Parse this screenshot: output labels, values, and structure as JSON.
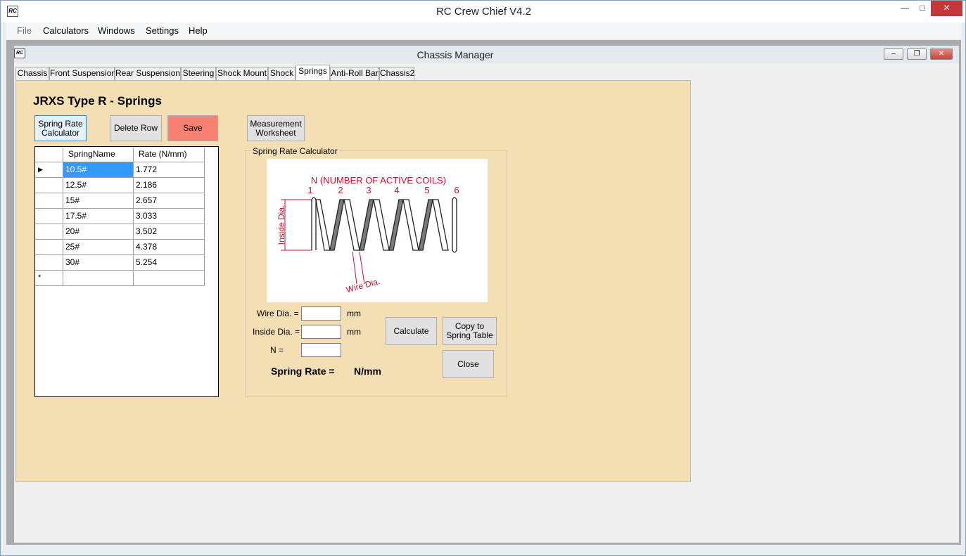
{
  "app": {
    "title": "RC Crew Chief V4.2",
    "icon_text": "RC",
    "minimize_glyph": "—",
    "maximize_glyph": "□",
    "close_glyph": "✕"
  },
  "menu": [
    "File",
    "Calculators",
    "Windows",
    "Settings",
    "Help"
  ],
  "child_window": {
    "title": "Chassis Manager",
    "icon_text": "RC",
    "min_glyph": "–",
    "restore_glyph": "❐",
    "close_glyph": "✕"
  },
  "tabs": [
    "Chassis",
    "Front Suspension",
    "Rear Suspension",
    "Steering",
    "Shock Mount",
    "Shock",
    "Springs",
    "Anti-Roll Bar",
    "Chassis2"
  ],
  "active_tab": "Springs",
  "page": {
    "heading": "JRXS Type R - Springs",
    "buttons": {
      "spring_rate_calc": "Spring Rate Calculator",
      "delete_row": "Delete Row",
      "save": "Save",
      "measurement": "Measurement Worksheet"
    },
    "save_color": "#fa8072",
    "panel_color": "#f4deb4"
  },
  "grid": {
    "columns": [
      "SpringName",
      "Rate (N/mm)"
    ],
    "rows": [
      {
        "name": "10.5#",
        "rate": "1.772"
      },
      {
        "name": "12.5#",
        "rate": "2.186"
      },
      {
        "name": "15#",
        "rate": "2.657"
      },
      {
        "name": "17.5#",
        "rate": "3.033"
      },
      {
        "name": "20#",
        "rate": "3.502"
      },
      {
        "name": "25#",
        "rate": "4.378"
      },
      {
        "name": "30#",
        "rate": "5.254"
      }
    ],
    "current_row_marker": "▶",
    "new_row_marker": "*"
  },
  "calculator": {
    "legend": "Spring Rate Calculator",
    "diagram": {
      "title": "N (NUMBER OF ACTIVE COILS)",
      "coil_numbers": [
        "1",
        "2",
        "3",
        "4",
        "5",
        "6"
      ],
      "inside_dia_label": "Inside Dia.",
      "wire_dia_label": "Wire Dia."
    },
    "fields": {
      "wire_dia_label": "Wire Dia. =",
      "wire_dia_value": "",
      "wire_dia_unit": "mm",
      "inside_dia_label": "Inside Dia. =",
      "inside_dia_value": "",
      "inside_dia_unit": "mm",
      "n_label": "N =",
      "n_value": ""
    },
    "buttons": {
      "calculate": "Calculate",
      "copy": "Copy to Spring Table",
      "close": "Close"
    },
    "result_label": "Spring Rate =",
    "result_unit": "N/mm"
  }
}
